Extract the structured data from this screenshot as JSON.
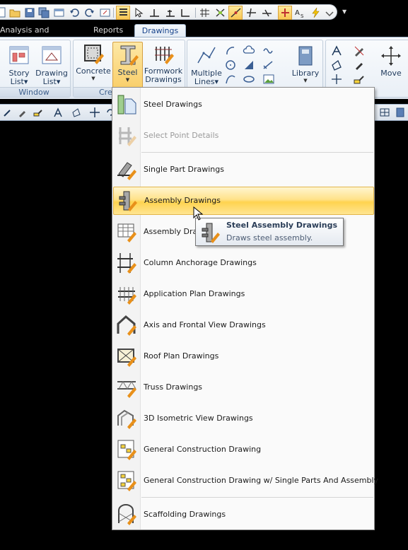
{
  "ribbon_tabs": [
    {
      "label": "Analysis and Design"
    },
    {
      "label": "Reports"
    },
    {
      "label": "Drawings",
      "active": true
    }
  ],
  "ribbon": {
    "window_group": {
      "label": "Window",
      "buttons": [
        {
          "label": "Story\nList",
          "icon": "story-list-icon"
        },
        {
          "label": "Drawing\nList",
          "icon": "drawing-list-icon"
        }
      ]
    },
    "create_group": {
      "label": "Cre",
      "buttons": [
        {
          "label": "Concrete",
          "icon": "concrete-icon"
        },
        {
          "label": "Steel",
          "icon": "steel-beam-icon",
          "selected": true
        },
        {
          "label": "Formwork\nDrawings",
          "icon": "formwork-icon"
        }
      ]
    },
    "draw_group": {
      "buttons": [
        {
          "label": "Multiple\nLines",
          "icon": "multiple-lines-icon"
        },
        {
          "label": "Library",
          "icon": "library-icon"
        }
      ]
    },
    "edit_group": {
      "buttons": [
        {
          "label": "Move",
          "icon": "move-icon"
        }
      ]
    }
  },
  "steel_menu": {
    "items": [
      {
        "label": "Steel Drawings",
        "icon": "steel-drawings-icon",
        "enabled": true
      },
      {
        "label": "Select Point Details",
        "icon": "point-details-icon",
        "enabled": false
      },
      {
        "label": "Single Part Drawings",
        "icon": "single-part-icon",
        "enabled": true
      },
      {
        "label": "Assembly Drawings",
        "icon": "assembly-icon",
        "enabled": true,
        "hover": true
      },
      {
        "label": "Assembly Draw",
        "icon": "assembly-list-icon",
        "enabled": true
      },
      {
        "label": "Column Anchorage Drawings",
        "icon": "column-anchorage-icon",
        "enabled": true
      },
      {
        "label": "Application Plan Drawings",
        "icon": "application-plan-icon",
        "enabled": true
      },
      {
        "label": "Axis and Frontal View Drawings",
        "icon": "axis-frontal-icon",
        "enabled": true
      },
      {
        "label": "Roof Plan Drawings",
        "icon": "roof-plan-icon",
        "enabled": true
      },
      {
        "label": "Truss Drawings",
        "icon": "truss-icon",
        "enabled": true
      },
      {
        "label": "3D Isometric View Drawings",
        "icon": "isometric-icon",
        "enabled": true
      },
      {
        "label": "General Construction Drawing",
        "icon": "general-construction-icon",
        "enabled": true
      },
      {
        "label": "General Construction Drawing w/ Single Parts And Assembly",
        "icon": "general-construction-assembly-icon",
        "enabled": true
      },
      {
        "label": "Scaffolding Drawings",
        "icon": "scaffolding-icon",
        "enabled": true
      }
    ]
  },
  "tooltip": {
    "title": "Steel Assembly Drawings",
    "description": "Draws steel assembly."
  },
  "colors": {
    "hover_highlight": "#ffd34f",
    "tab_active_text": "#15428b",
    "ribbon_label": "#1e395b",
    "pencil_orange": "#e8901a"
  }
}
